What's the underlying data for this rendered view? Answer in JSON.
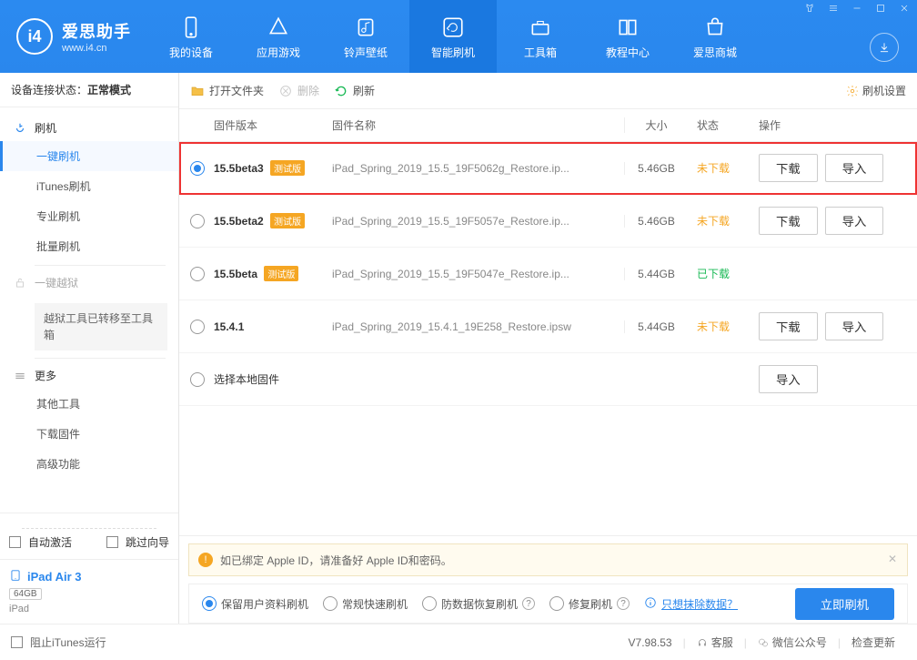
{
  "app": {
    "name": "爱思助手",
    "url": "www.i4.cn"
  },
  "nav": {
    "items": [
      {
        "label": "我的设备"
      },
      {
        "label": "应用游戏"
      },
      {
        "label": "铃声壁纸"
      },
      {
        "label": "智能刷机"
      },
      {
        "label": "工具箱"
      },
      {
        "label": "教程中心"
      },
      {
        "label": "爱思商城"
      }
    ]
  },
  "sidebar": {
    "connection_label": "设备连接状态：",
    "connection_value": "正常模式",
    "flash_header": "刷机",
    "items": [
      "一键刷机",
      "iTunes刷机",
      "专业刷机",
      "批量刷机"
    ],
    "jailbreak": "一键越狱",
    "jailbreak_note": "越狱工具已转移至工具箱",
    "more_header": "更多",
    "more_items": [
      "其他工具",
      "下载固件",
      "高级功能"
    ],
    "auto_activate": "自动激活",
    "skip_guide": "跳过向导",
    "device": {
      "name": "iPad Air 3",
      "capacity": "64GB",
      "type": "iPad"
    }
  },
  "toolbar": {
    "open_folder": "打开文件夹",
    "delete": "删除",
    "refresh": "刷新",
    "settings": "刷机设置"
  },
  "table": {
    "headers": {
      "version": "固件版本",
      "name": "固件名称",
      "size": "大小",
      "status": "状态",
      "action": "操作"
    },
    "badge": "测试版",
    "btn_download": "下载",
    "btn_import": "导入",
    "select_local": "选择本地固件",
    "rows": [
      {
        "ver": "15.5beta3",
        "beta": true,
        "name": "iPad_Spring_2019_15.5_19F5062g_Restore.ip...",
        "size": "5.46GB",
        "status": "未下载",
        "status_color": "orange",
        "downloadable": true
      },
      {
        "ver": "15.5beta2",
        "beta": true,
        "name": "iPad_Spring_2019_15.5_19F5057e_Restore.ip...",
        "size": "5.46GB",
        "status": "未下载",
        "status_color": "orange",
        "downloadable": true
      },
      {
        "ver": "15.5beta",
        "beta": true,
        "name": "iPad_Spring_2019_15.5_19F5047e_Restore.ip...",
        "size": "5.44GB",
        "status": "已下载",
        "status_color": "green",
        "downloadable": false
      },
      {
        "ver": "15.4.1",
        "beta": false,
        "name": "iPad_Spring_2019_15.4.1_19E258_Restore.ipsw",
        "size": "5.44GB",
        "status": "未下载",
        "status_color": "orange",
        "downloadable": true
      }
    ]
  },
  "notice": "如已绑定 Apple ID，请准备好 Apple ID和密码。",
  "modes": {
    "items": [
      {
        "label": "保留用户资料刷机",
        "help": false
      },
      {
        "label": "常规快速刷机",
        "help": false
      },
      {
        "label": "防数据恢复刷机",
        "help": true
      },
      {
        "label": "修复刷机",
        "help": true
      }
    ],
    "clear_link": "只想抹除数据？",
    "flash_now": "立即刷机"
  },
  "footer": {
    "block_itunes": "阻止iTunes运行",
    "version": "V7.98.53",
    "support": "客服",
    "wechat": "微信公众号",
    "update": "检查更新"
  }
}
